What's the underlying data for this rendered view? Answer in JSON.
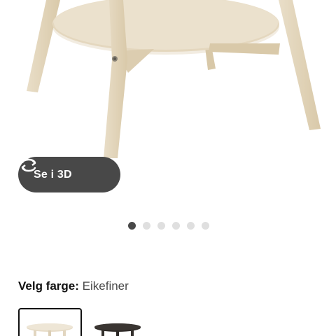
{
  "product_gallery": {
    "view_in_3d_label": "Se i 3D",
    "icons": {
      "rotate": "rotate-3d-icon"
    },
    "slides": [
      {
        "name": "slide-1",
        "active": true
      },
      {
        "name": "slide-2",
        "active": false
      },
      {
        "name": "slide-3",
        "active": false
      },
      {
        "name": "slide-4",
        "active": false
      },
      {
        "name": "slide-5",
        "active": false
      },
      {
        "name": "slide-6",
        "active": false
      }
    ]
  },
  "color_picker": {
    "label": "Velg farge:",
    "selected_value": "Eikefiner",
    "options": [
      {
        "name": "Eikefiner",
        "selected": true,
        "color": "#e7dcc8"
      },
      {
        "name": "dark",
        "selected": false,
        "color": "#3a3532"
      }
    ]
  },
  "colors": {
    "wood": "#e4d7bf",
    "wood_shade": "#d6c6a6",
    "button_bg": "#484848",
    "dot_active": "#484848",
    "dot_inactive": "#dfdfdf"
  }
}
